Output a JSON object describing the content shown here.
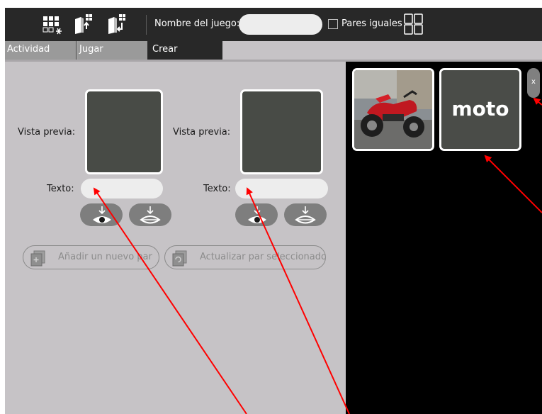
{
  "toolbar": {
    "icons": [
      "grid-new-icon",
      "export-icon",
      "import-icon"
    ],
    "game_name_label": "Nombre del juego:",
    "game_name_value": "",
    "equal_pairs_label": "Pares iguales",
    "equal_pairs_checked": false,
    "layout_icon": "layout-grid-icon"
  },
  "tabs": [
    {
      "label": "Actividad",
      "active": false
    },
    {
      "label": "Jugar",
      "active": false
    },
    {
      "label": "Crear",
      "active": true
    }
  ],
  "editor": {
    "cards": [
      {
        "preview_label": "Vista previa:",
        "text_label": "Texto:",
        "text_value": "",
        "buttons": [
          "load-image-icon",
          "record-audio-icon"
        ]
      },
      {
        "preview_label": "Vista previa:",
        "text_label": "Texto:",
        "text_value": "",
        "buttons": [
          "load-image-icon",
          "record-audio-icon"
        ]
      }
    ],
    "add_pair_label": "Añadir un nuevo par",
    "update_pair_label": "Actualizar par seleccionado"
  },
  "gallery": {
    "items": [
      {
        "type": "image",
        "icon": "motorcycle-photo"
      },
      {
        "type": "text",
        "text": "moto"
      }
    ],
    "delete_label": "x"
  },
  "colors": {
    "toolbar_bg": "#282828",
    "panel_bg": "#c6c3c6",
    "preview_bg": "#484b46",
    "gallery_bg": "#000000",
    "annotation": "#ff0000"
  }
}
